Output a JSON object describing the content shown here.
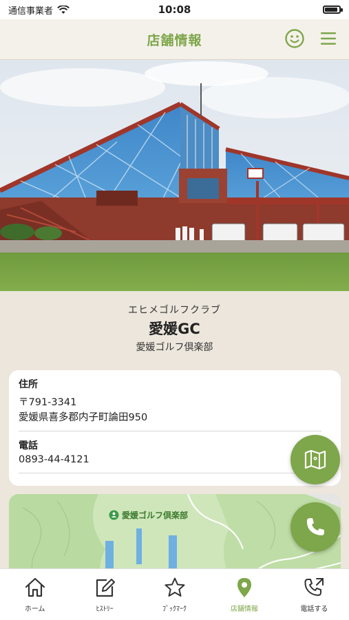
{
  "status_bar": {
    "carrier": "通信事業者",
    "time": "10:08",
    "battery_level": 0.9
  },
  "header": {
    "title": "店舗情報",
    "accent_color": "#7ea64a"
  },
  "store": {
    "kana": "エヒメゴルフクラブ",
    "short_name": "愛媛GC",
    "full_name": "愛媛ゴルフ倶楽部"
  },
  "info": {
    "address_label": "住所",
    "postal_code": "〒791-3341",
    "address": "愛媛県喜多郡内子町論田950",
    "phone_label": "電話",
    "phone": "0893-44-4121"
  },
  "map": {
    "pin_label": "愛媛ゴルフ倶楽部"
  },
  "tabs": [
    {
      "label": "ホーム",
      "icon": "home-icon",
      "active": false
    },
    {
      "label": "ﾋｽﾄﾘｰ",
      "icon": "edit-icon",
      "active": false
    },
    {
      "label": "ﾌﾞｯｸﾏｰｸ",
      "icon": "star-icon",
      "active": false
    },
    {
      "label": "店舗情報",
      "icon": "location-pin-icon",
      "active": true
    },
    {
      "label": "電話する",
      "icon": "phone-call-icon",
      "active": false
    }
  ]
}
